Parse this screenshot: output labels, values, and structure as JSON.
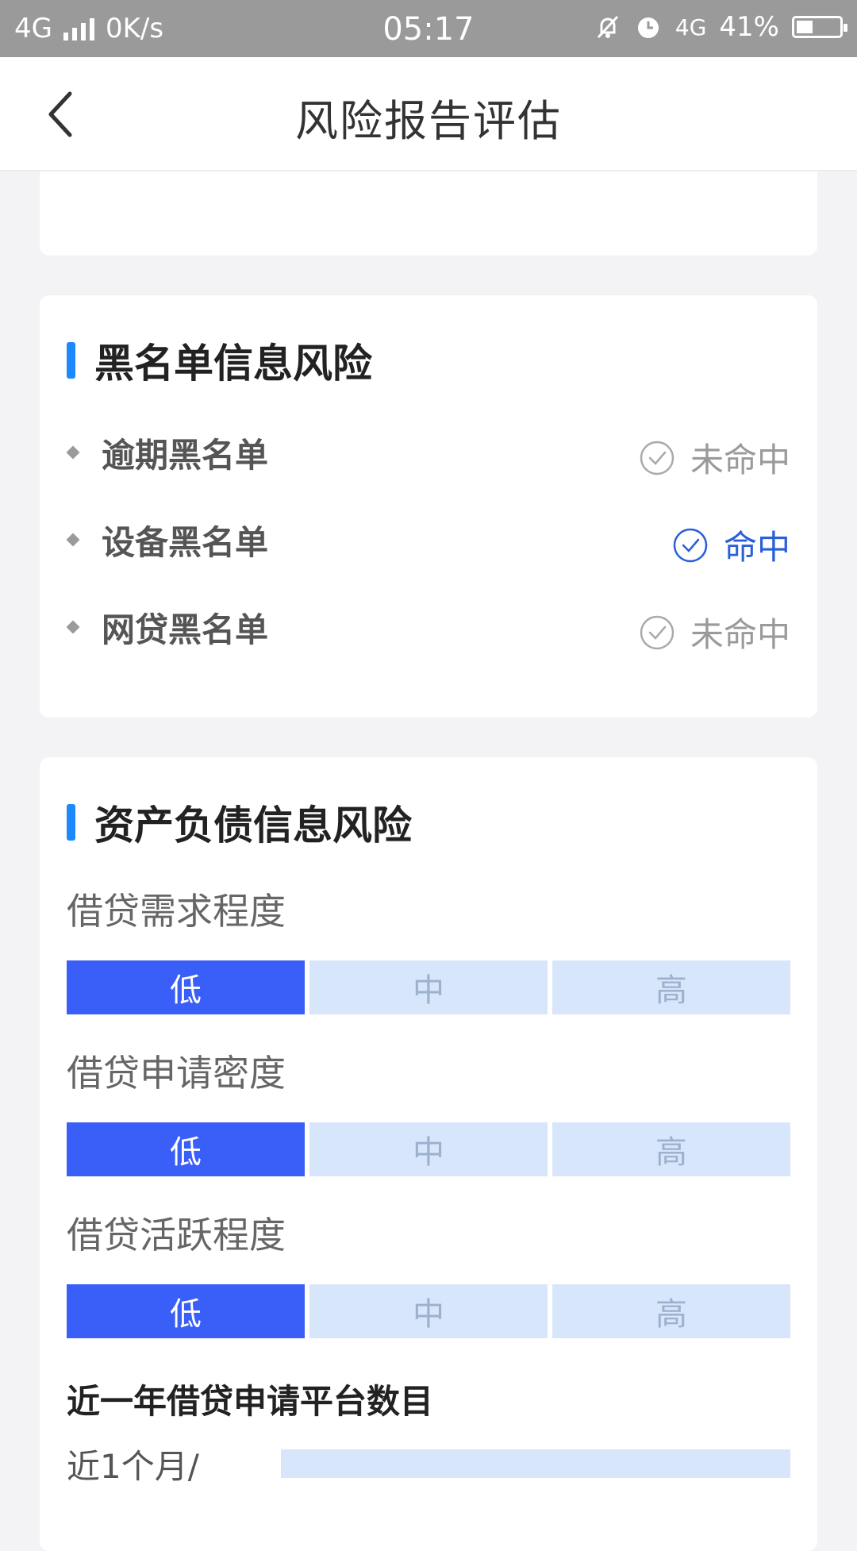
{
  "status_bar": {
    "network": "4G",
    "speed": "0K/s",
    "time": "05:17",
    "network_right": "4G",
    "battery": "41%"
  },
  "header": {
    "title": "风险报告评估",
    "back_icon": "chevron-left-icon"
  },
  "blacklist": {
    "title": "黑名单信息风险",
    "items": [
      {
        "label": "逾期黑名单",
        "status": "未命中",
        "hit": false
      },
      {
        "label": "设备黑名单",
        "status": "命中",
        "hit": true
      },
      {
        "label": "网贷黑名单",
        "status": "未命中",
        "hit": false
      }
    ]
  },
  "assets": {
    "title": "资产负债信息风险",
    "meters": [
      {
        "label": "借贷需求程度",
        "levels": [
          "低",
          "中",
          "高"
        ],
        "selected": "低"
      },
      {
        "label": "借贷申请密度",
        "levels": [
          "低",
          "中",
          "高"
        ],
        "selected": "低"
      },
      {
        "label": "借贷活跃程度",
        "levels": [
          "低",
          "中",
          "高"
        ],
        "selected": "低"
      }
    ],
    "platform_count_title": "近一年借贷申请平台数目",
    "periods": [
      {
        "label": "近1个月/"
      }
    ]
  },
  "colors": {
    "accent": "#1e88ff",
    "active_level": "#3a5ef8",
    "inactive_level": "#d8e6fb",
    "hit_text": "#2a5fd8"
  }
}
